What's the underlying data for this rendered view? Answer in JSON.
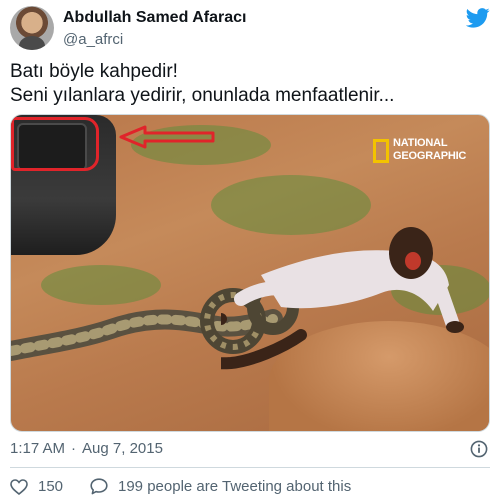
{
  "author": {
    "display_name": "Abdullah Samed Afaracı",
    "handle": "@a_afrci"
  },
  "tweet": {
    "lines": [
      "Batı böyle kahpedir!",
      "Seni yılanlara yedirir, onunlada menfaatlenir..."
    ]
  },
  "media": {
    "logo_line1": "NATIONAL",
    "logo_line2": "GEOGRAPHIC",
    "logo_color": "#f3c300",
    "annotation_color": "#e0242a"
  },
  "meta": {
    "time": "1:17 AM",
    "separator": "·",
    "date": "Aug 7, 2015"
  },
  "actions": {
    "likes": "150",
    "tweeting_text": "199 people are Tweeting about this"
  },
  "icons": {
    "brand": "twitter-bird-icon",
    "info": "info-icon",
    "like": "heart-icon",
    "reply": "speech-bubble-icon"
  },
  "colors": {
    "twitter_blue": "#1d9bf0",
    "muted": "#536471"
  }
}
